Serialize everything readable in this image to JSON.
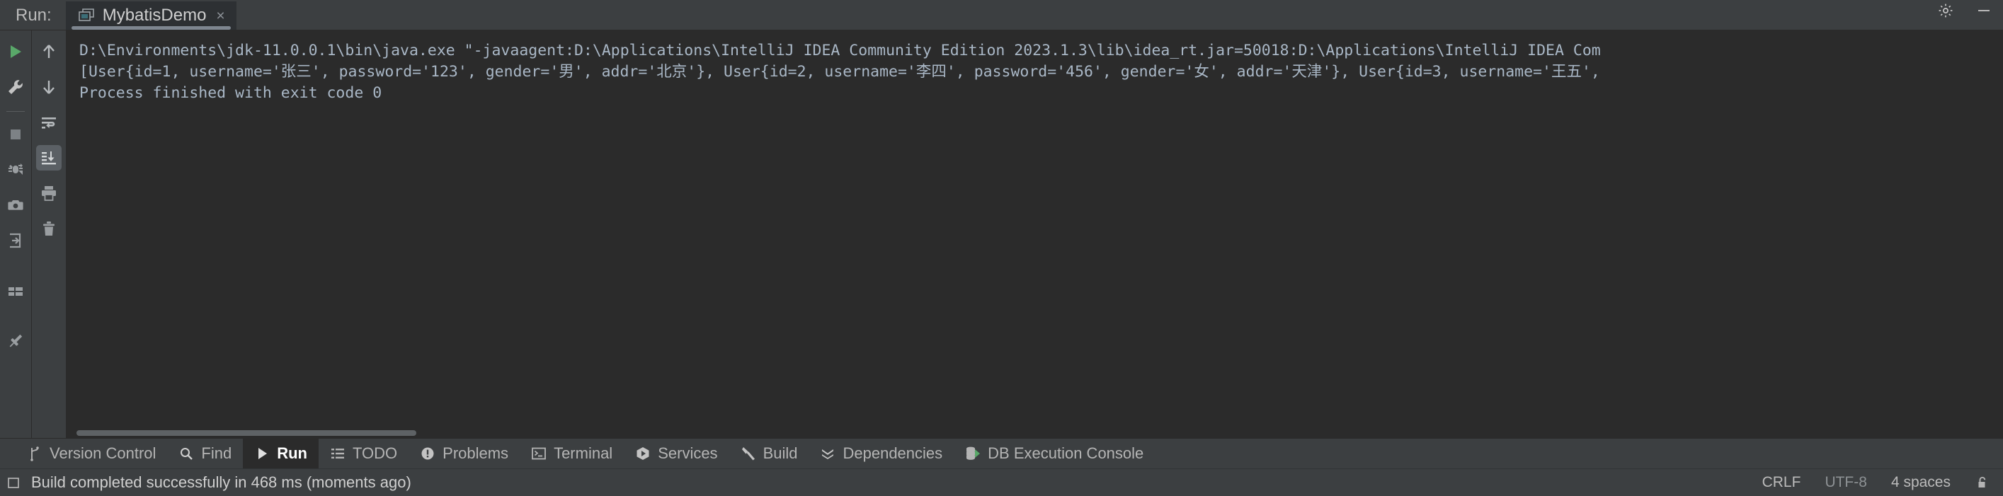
{
  "window": {
    "run_label": "Run:",
    "settings_icon": "gear-icon",
    "minimize_icon": "minimize-icon"
  },
  "tab": {
    "title": "MybatisDemo",
    "icon": "run-configuration-icon",
    "close_label": "×"
  },
  "run_toolbar": {
    "items": [
      {
        "name": "rerun-button",
        "icon": "play-icon",
        "label": "Rerun"
      },
      {
        "name": "edit-configuration-button",
        "icon": "wrench-icon",
        "label": "Edit Configuration"
      },
      {
        "name": "stop-button",
        "icon": "stop-square-icon",
        "label": "Stop"
      },
      {
        "name": "attach-debugger-button",
        "icon": "bug-attach-icon",
        "label": "Attach Debugger"
      },
      {
        "name": "snapshot-button",
        "icon": "camera-icon",
        "label": "Snapshot"
      },
      {
        "name": "dump-threads-button",
        "icon": "export-arrow-icon",
        "label": "Dump Threads"
      },
      {
        "name": "layout-button",
        "icon": "layout-grid-icon",
        "label": "Layout"
      },
      {
        "name": "pin-tab-button",
        "icon": "pin-icon",
        "label": "Pin Tab"
      }
    ]
  },
  "console_toolbar": {
    "items": [
      {
        "name": "previous-occurrence-button",
        "icon": "arrow-up-icon",
        "label": "Up the Stack Trace",
        "selected": false
      },
      {
        "name": "next-occurrence-button",
        "icon": "arrow-down-icon",
        "label": "Down the Stack Trace",
        "selected": false
      },
      {
        "name": "soft-wrap-button",
        "icon": "soft-wrap-icon",
        "label": "Soft-Wrap",
        "selected": false
      },
      {
        "name": "scroll-to-end-button",
        "icon": "scroll-to-end-icon",
        "label": "Scroll to End",
        "selected": true
      },
      {
        "name": "print-button",
        "icon": "printer-icon",
        "label": "Print",
        "selected": false
      },
      {
        "name": "clear-all-button",
        "icon": "trash-icon",
        "label": "Clear All",
        "selected": false
      }
    ]
  },
  "console": {
    "lines": [
      "D:\\Environments\\jdk-11.0.0.1\\bin\\java.exe \"-javaagent:D:\\Applications\\IntelliJ IDEA Community Edition 2023.1.3\\lib\\idea_rt.jar=50018:D:\\Applications\\IntelliJ IDEA Com",
      "[User{id=1, username='张三', password='123', gender='男', addr='北京'}, User{id=2, username='李四', password='456', gender='女', addr='天津'}, User{id=3, username='王五',",
      "",
      "Process finished with exit code 0"
    ],
    "text_color": "#a9b7c6"
  },
  "tool_windows": {
    "items": [
      {
        "name": "tool-window-version-control",
        "label": "Version Control",
        "icon": "branch-icon",
        "active": false
      },
      {
        "name": "tool-window-find",
        "label": "Find",
        "icon": "magnifier-icon",
        "active": false
      },
      {
        "name": "tool-window-run",
        "label": "Run",
        "icon": "play-icon",
        "active": true
      },
      {
        "name": "tool-window-todo",
        "label": "TODO",
        "icon": "list-icon",
        "active": false
      },
      {
        "name": "tool-window-problems",
        "label": "Problems",
        "icon": "exclamation-circle-icon",
        "active": false
      },
      {
        "name": "tool-window-terminal",
        "label": "Terminal",
        "icon": "terminal-icon",
        "active": false
      },
      {
        "name": "tool-window-services",
        "label": "Services",
        "icon": "services-icon",
        "active": false
      },
      {
        "name": "tool-window-build",
        "label": "Build",
        "icon": "hammer-icon",
        "active": false
      },
      {
        "name": "tool-window-dependencies",
        "label": "Dependencies",
        "icon": "chevrons-down-icon",
        "active": false
      },
      {
        "name": "tool-window-db-execution-console",
        "label": "DB Execution Console",
        "icon": "database-run-icon",
        "active": false
      }
    ]
  },
  "status_bar": {
    "message": "Build completed successfully in 468 ms (moments ago)",
    "left_icon": "event-log-icon",
    "line_separator": "CRLF",
    "encoding": "UTF-8",
    "indent": "4 spaces",
    "lock_icon": "unlocked-icon"
  },
  "colors": {
    "accent_green": "#59a869",
    "panel_bg": "#3c3f41",
    "console_bg": "#2b2b2b",
    "tab_bg": "#2d3033",
    "text": "#bbbbbb",
    "console_text": "#a9b7c6"
  }
}
